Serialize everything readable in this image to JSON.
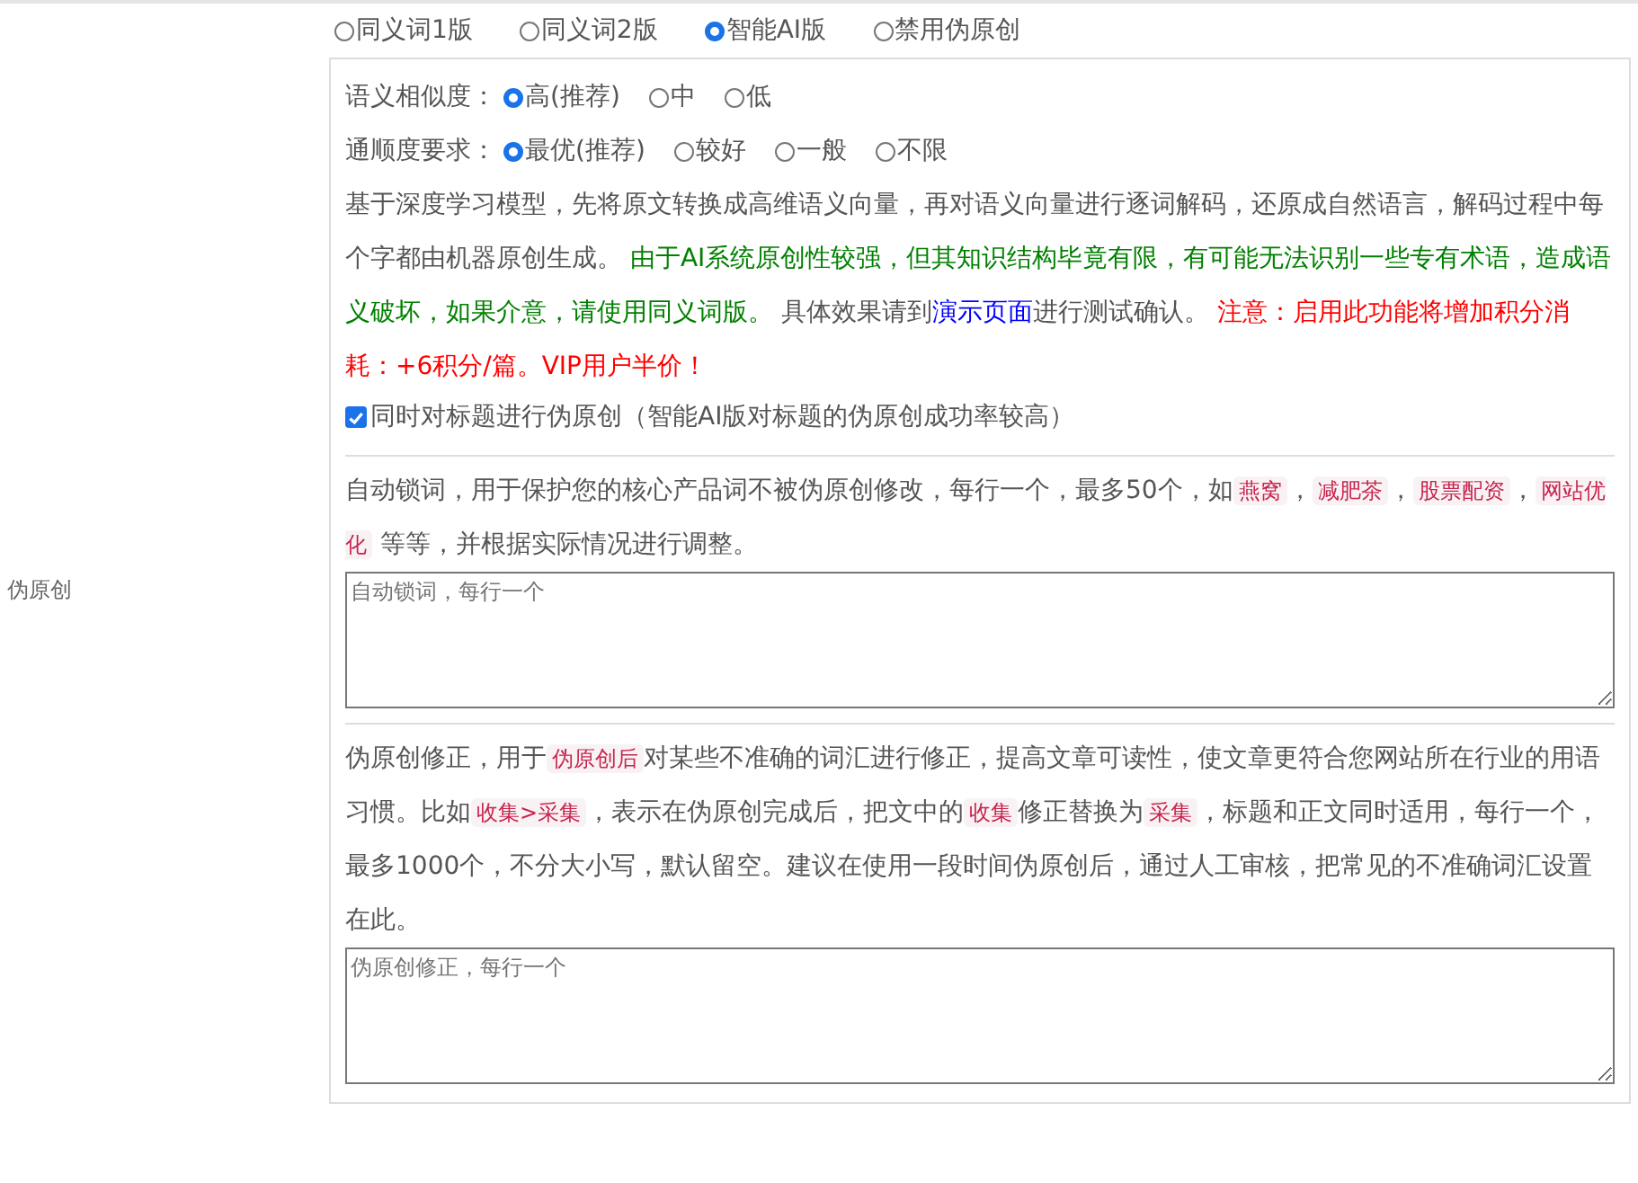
{
  "mode_options": [
    {
      "label": "同义词1版",
      "selected": false
    },
    {
      "label": "同义词2版",
      "selected": false
    },
    {
      "label": "智能AI版",
      "selected": true
    },
    {
      "label": "禁用伪原创",
      "selected": false
    }
  ],
  "similarity": {
    "label": "语义相似度：",
    "options": [
      {
        "label": "高(推荐)",
        "selected": true
      },
      {
        "label": "中",
        "selected": false
      },
      {
        "label": "低",
        "selected": false
      }
    ]
  },
  "fluency": {
    "label": "通顺度要求：",
    "options": [
      {
        "label": "最优(推荐)",
        "selected": true
      },
      {
        "label": "较好",
        "selected": false
      },
      {
        "label": "一般",
        "selected": false
      },
      {
        "label": "不限",
        "selected": false
      }
    ]
  },
  "description": [
    {
      "kind": "text",
      "text": "基于深度学习模型，先将原文转换成高维语义向量，再对语义向量进行逐词解码，还原成自然语言，解码过程中每个字都由机器原创生成。 "
    },
    {
      "kind": "green",
      "text": "由于AI系统原创性较强，但其知识结构毕竟有限，有可能无法识别一些专有术语，造成语义破坏，如果介意，请使用同义词版。"
    },
    {
      "kind": "text",
      "text": " 具体效果请到"
    },
    {
      "kind": "link",
      "text": "演示页面"
    },
    {
      "kind": "text",
      "text": "进行测试确认。 "
    },
    {
      "kind": "red",
      "text": "注意：启用此功能将增加积分消耗：+6积分/篇。VIP用户半价！"
    }
  ],
  "title_checkbox": {
    "label": "同时对标题进行伪原创（智能AI版对标题的伪原创成功率较高）",
    "checked": true
  },
  "section_label": "伪原创",
  "lock_words": {
    "description": [
      {
        "kind": "text",
        "text": "自动锁词，用于保护您的核心产品词不被伪原创修改，每行一个，最多50个，如"
      },
      {
        "kind": "code",
        "text": "燕窝"
      },
      {
        "kind": "text",
        "text": "，"
      },
      {
        "kind": "code",
        "text": "减肥茶"
      },
      {
        "kind": "text",
        "text": "，"
      },
      {
        "kind": "code",
        "text": "股票配资"
      },
      {
        "kind": "text",
        "text": "，"
      },
      {
        "kind": "code",
        "text": "网站优化"
      },
      {
        "kind": "text",
        "text": " 等等，并根据实际情况进行调整。"
      }
    ],
    "placeholder": "自动锁词，每行一个"
  },
  "correction": {
    "description": [
      {
        "kind": "text",
        "text": "伪原创修正，用于"
      },
      {
        "kind": "code",
        "text": "伪原创后"
      },
      {
        "kind": "text",
        "text": "对某些不准确的词汇进行修正，提高文章可读性，使文章更符合您网站所在行业的用语习惯。比如"
      },
      {
        "kind": "code",
        "text": "收集>采集"
      },
      {
        "kind": "text",
        "text": "，表示在伪原创完成后，把文中的"
      },
      {
        "kind": "code",
        "text": "收集"
      },
      {
        "kind": "text",
        "text": "修正替换为"
      },
      {
        "kind": "code",
        "text": "采集"
      },
      {
        "kind": "text",
        "text": "，标题和正文同时适用，每行一个，最多1000个，不分大小写，默认留空。建议在使用一段时间伪原创后，通过人工审核，把常见的不准确词汇设置在此。"
      }
    ],
    "placeholder": "伪原创修正，每行一个"
  }
}
